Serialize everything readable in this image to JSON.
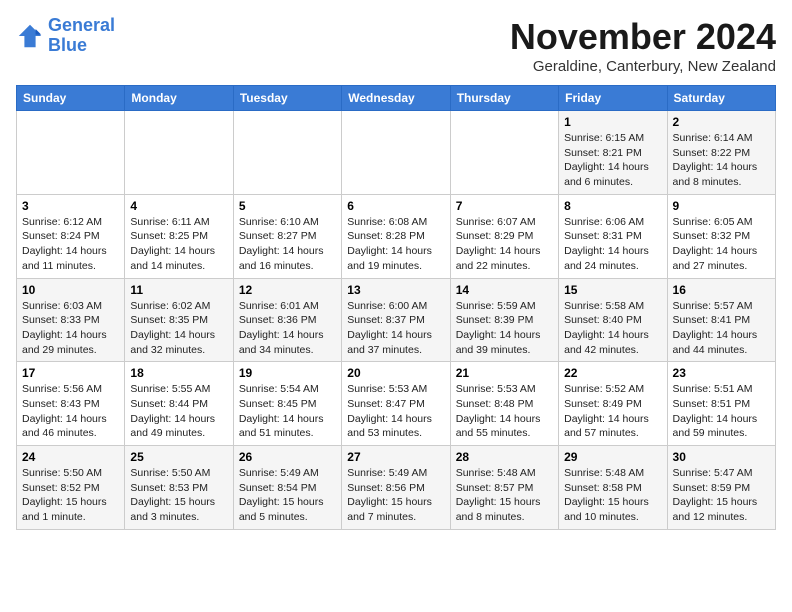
{
  "header": {
    "logo_line1": "General",
    "logo_line2": "Blue",
    "month": "November 2024",
    "location": "Geraldine, Canterbury, New Zealand"
  },
  "days_of_week": [
    "Sunday",
    "Monday",
    "Tuesday",
    "Wednesday",
    "Thursday",
    "Friday",
    "Saturday"
  ],
  "weeks": [
    [
      {
        "day": "",
        "content": ""
      },
      {
        "day": "",
        "content": ""
      },
      {
        "day": "",
        "content": ""
      },
      {
        "day": "",
        "content": ""
      },
      {
        "day": "",
        "content": ""
      },
      {
        "day": "1",
        "content": "Sunrise: 6:15 AM\nSunset: 8:21 PM\nDaylight: 14 hours\nand 6 minutes."
      },
      {
        "day": "2",
        "content": "Sunrise: 6:14 AM\nSunset: 8:22 PM\nDaylight: 14 hours\nand 8 minutes."
      }
    ],
    [
      {
        "day": "3",
        "content": "Sunrise: 6:12 AM\nSunset: 8:24 PM\nDaylight: 14 hours\nand 11 minutes."
      },
      {
        "day": "4",
        "content": "Sunrise: 6:11 AM\nSunset: 8:25 PM\nDaylight: 14 hours\nand 14 minutes."
      },
      {
        "day": "5",
        "content": "Sunrise: 6:10 AM\nSunset: 8:27 PM\nDaylight: 14 hours\nand 16 minutes."
      },
      {
        "day": "6",
        "content": "Sunrise: 6:08 AM\nSunset: 8:28 PM\nDaylight: 14 hours\nand 19 minutes."
      },
      {
        "day": "7",
        "content": "Sunrise: 6:07 AM\nSunset: 8:29 PM\nDaylight: 14 hours\nand 22 minutes."
      },
      {
        "day": "8",
        "content": "Sunrise: 6:06 AM\nSunset: 8:31 PM\nDaylight: 14 hours\nand 24 minutes."
      },
      {
        "day": "9",
        "content": "Sunrise: 6:05 AM\nSunset: 8:32 PM\nDaylight: 14 hours\nand 27 minutes."
      }
    ],
    [
      {
        "day": "10",
        "content": "Sunrise: 6:03 AM\nSunset: 8:33 PM\nDaylight: 14 hours\nand 29 minutes."
      },
      {
        "day": "11",
        "content": "Sunrise: 6:02 AM\nSunset: 8:35 PM\nDaylight: 14 hours\nand 32 minutes."
      },
      {
        "day": "12",
        "content": "Sunrise: 6:01 AM\nSunset: 8:36 PM\nDaylight: 14 hours\nand 34 minutes."
      },
      {
        "day": "13",
        "content": "Sunrise: 6:00 AM\nSunset: 8:37 PM\nDaylight: 14 hours\nand 37 minutes."
      },
      {
        "day": "14",
        "content": "Sunrise: 5:59 AM\nSunset: 8:39 PM\nDaylight: 14 hours\nand 39 minutes."
      },
      {
        "day": "15",
        "content": "Sunrise: 5:58 AM\nSunset: 8:40 PM\nDaylight: 14 hours\nand 42 minutes."
      },
      {
        "day": "16",
        "content": "Sunrise: 5:57 AM\nSunset: 8:41 PM\nDaylight: 14 hours\nand 44 minutes."
      }
    ],
    [
      {
        "day": "17",
        "content": "Sunrise: 5:56 AM\nSunset: 8:43 PM\nDaylight: 14 hours\nand 46 minutes."
      },
      {
        "day": "18",
        "content": "Sunrise: 5:55 AM\nSunset: 8:44 PM\nDaylight: 14 hours\nand 49 minutes."
      },
      {
        "day": "19",
        "content": "Sunrise: 5:54 AM\nSunset: 8:45 PM\nDaylight: 14 hours\nand 51 minutes."
      },
      {
        "day": "20",
        "content": "Sunrise: 5:53 AM\nSunset: 8:47 PM\nDaylight: 14 hours\nand 53 minutes."
      },
      {
        "day": "21",
        "content": "Sunrise: 5:53 AM\nSunset: 8:48 PM\nDaylight: 14 hours\nand 55 minutes."
      },
      {
        "day": "22",
        "content": "Sunrise: 5:52 AM\nSunset: 8:49 PM\nDaylight: 14 hours\nand 57 minutes."
      },
      {
        "day": "23",
        "content": "Sunrise: 5:51 AM\nSunset: 8:51 PM\nDaylight: 14 hours\nand 59 minutes."
      }
    ],
    [
      {
        "day": "24",
        "content": "Sunrise: 5:50 AM\nSunset: 8:52 PM\nDaylight: 15 hours\nand 1 minute."
      },
      {
        "day": "25",
        "content": "Sunrise: 5:50 AM\nSunset: 8:53 PM\nDaylight: 15 hours\nand 3 minutes."
      },
      {
        "day": "26",
        "content": "Sunrise: 5:49 AM\nSunset: 8:54 PM\nDaylight: 15 hours\nand 5 minutes."
      },
      {
        "day": "27",
        "content": "Sunrise: 5:49 AM\nSunset: 8:56 PM\nDaylight: 15 hours\nand 7 minutes."
      },
      {
        "day": "28",
        "content": "Sunrise: 5:48 AM\nSunset: 8:57 PM\nDaylight: 15 hours\nand 8 minutes."
      },
      {
        "day": "29",
        "content": "Sunrise: 5:48 AM\nSunset: 8:58 PM\nDaylight: 15 hours\nand 10 minutes."
      },
      {
        "day": "30",
        "content": "Sunrise: 5:47 AM\nSunset: 8:59 PM\nDaylight: 15 hours\nand 12 minutes."
      }
    ]
  ]
}
